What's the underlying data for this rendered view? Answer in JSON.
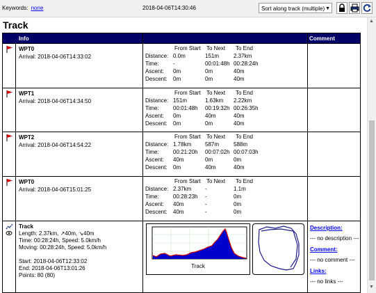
{
  "toolbar": {
    "keywords_label": "Keywords:",
    "keywords_value": "none",
    "timestamp": "2018-04-06T14:30:46",
    "sort_value": "Sort along track (multiple)"
  },
  "panel_title": "Track",
  "table": {
    "col_info": "Info",
    "col_comment": "Comment",
    "stat_headers": [
      "From Start",
      "To Next",
      "To End"
    ],
    "stat_labels": [
      "Distance:",
      "Time:",
      "Ascent:",
      "Descent:"
    ],
    "waypoints": [
      {
        "name": "WPT0",
        "arrival": "Arrival: 2018-04-06T14:33:02",
        "values": [
          [
            "0.0m",
            "151m",
            "2.37km"
          ],
          [
            "-",
            "00:01:48h",
            "00:28:24h"
          ],
          [
            "0m",
            "0m",
            "40m"
          ],
          [
            "0m",
            "0m",
            "40m"
          ]
        ]
      },
      {
        "name": "WPT1",
        "arrival": "Arrival: 2018-04-06T14:34:50",
        "values": [
          [
            "151m",
            "1.63km",
            "2.22km"
          ],
          [
            "00:01:48h",
            "00:19:32h",
            "00:26:35h"
          ],
          [
            "0m",
            "40m",
            "40m"
          ],
          [
            "0m",
            "0m",
            "40m"
          ]
        ]
      },
      {
        "name": "WPT2",
        "arrival": "Arrival: 2018-04-06T14:54:22",
        "values": [
          [
            "1.78km",
            "587m",
            "588m"
          ],
          [
            "00:21:20h",
            "00:07:02h",
            "00:07:03h"
          ],
          [
            "40m",
            "0m",
            "0m"
          ],
          [
            "0m",
            "40m",
            "40m"
          ]
        ]
      },
      {
        "name": "WPT0",
        "arrival": "Arrival: 2018-04-06T15:01:25",
        "values": [
          [
            "2.37km",
            "-",
            "1.1m"
          ],
          [
            "00:28:23h",
            "-",
            "0m"
          ],
          [
            "40m",
            "-",
            "0m"
          ],
          [
            "40m",
            "-",
            "0m"
          ]
        ]
      }
    ],
    "track": {
      "name": "Track",
      "lines": [
        "Length: 2.37km, ↗40m, ↘40m",
        "Time: 00:28:24h, Speed: 5.0km/h",
        "Moving: 00:28:24h, Speed: 5.0km/h",
        "",
        "Start: 2018-04-06T12:33:02",
        "End: 2018-04-06T13:01:26",
        "Points: 80 (80)"
      ],
      "profile_label": "Track",
      "comment": {
        "description_label": "Description:",
        "description_value": "--- no description ---",
        "comment_label": "Comment:",
        "comment_value": "--- no comment ---",
        "links_label": "Links:",
        "links_value": "--- no links ---"
      }
    }
  },
  "colors": {
    "header_bg": "#000066",
    "flag": "#d40000",
    "profile_fill": "#0000cc",
    "profile_line": "#cc0000",
    "link": "#0000ee"
  }
}
